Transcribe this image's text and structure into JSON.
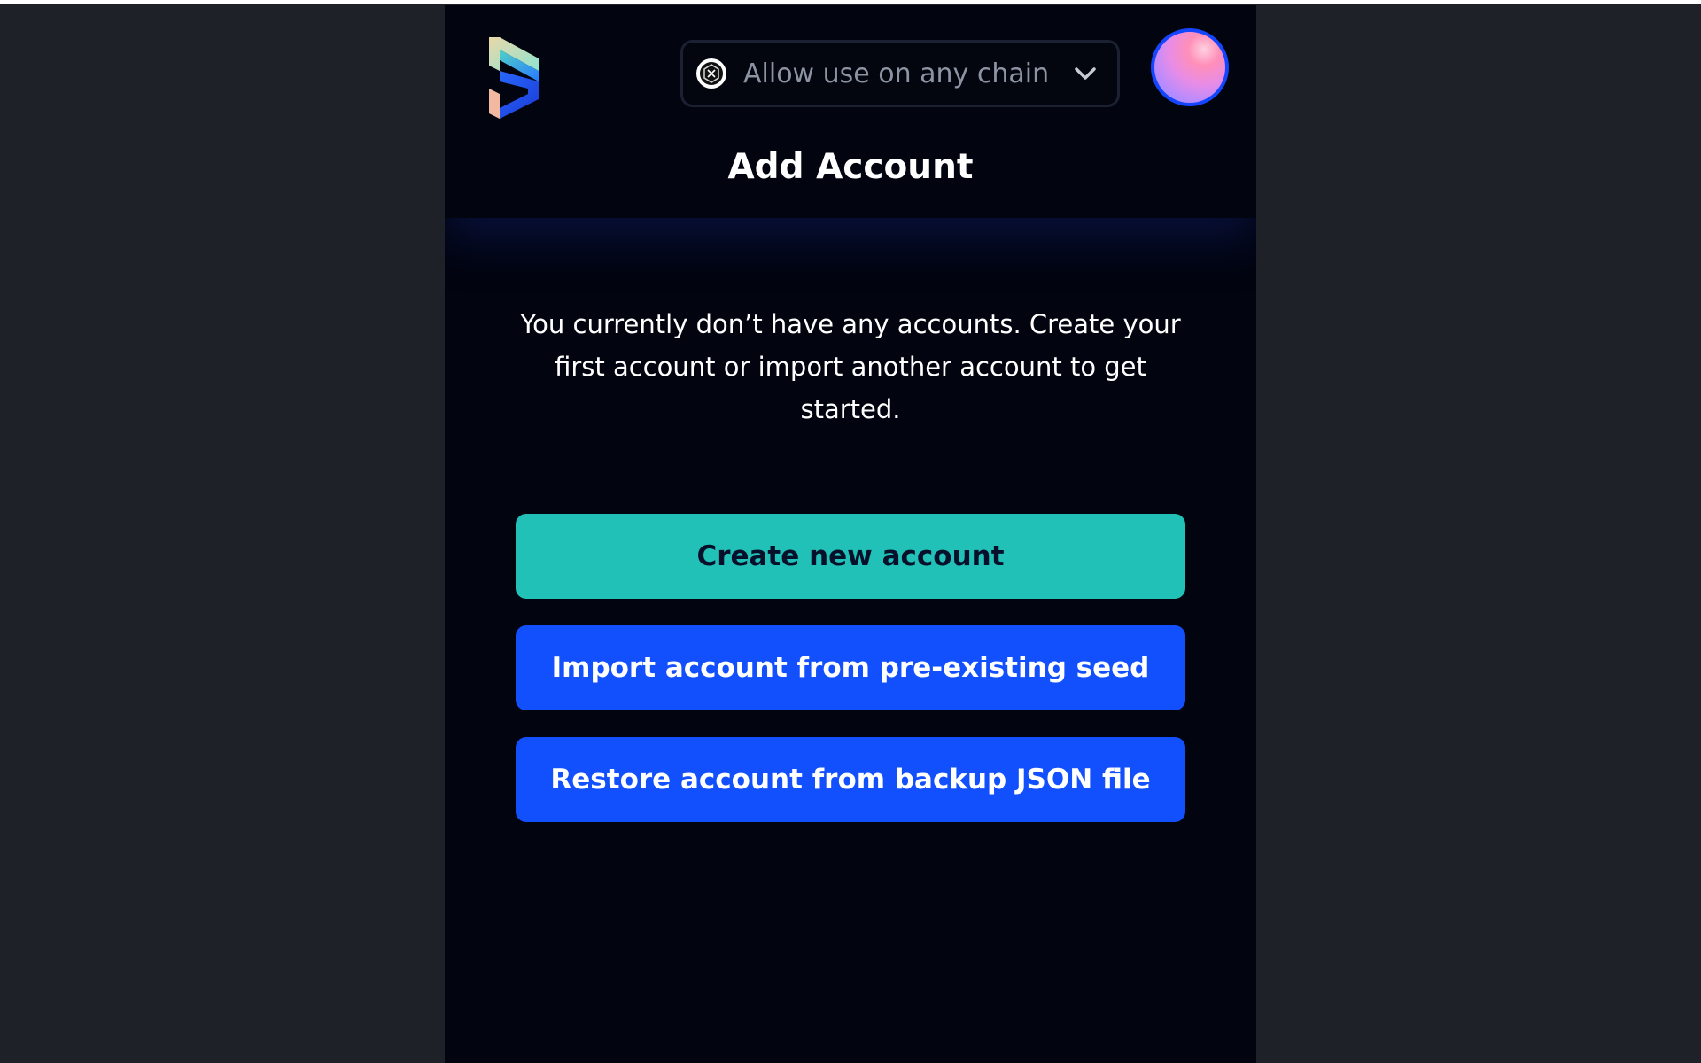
{
  "header": {
    "logo_icon": "brand-logo-icon",
    "chain_selector": {
      "icon": "chain-network-icon",
      "value": "Allow use on any chain",
      "dropdown_icon": "chevron-down-icon"
    },
    "avatar_icon": "account-avatar"
  },
  "page": {
    "title": "Add Account",
    "message": "You currently don’t have any accounts. Create your first account or import another account to get started."
  },
  "actions": {
    "create_label": "Create new account",
    "import_label": "Import account from pre-existing seed",
    "restore_label": "Restore account from backup JSON file"
  },
  "colors": {
    "background": "#1f2128",
    "panel": "#02040f",
    "primary_teal": "#21c1b8",
    "primary_blue": "#124ffd",
    "text": "#ffffff",
    "muted_text": "#8c93a3"
  }
}
